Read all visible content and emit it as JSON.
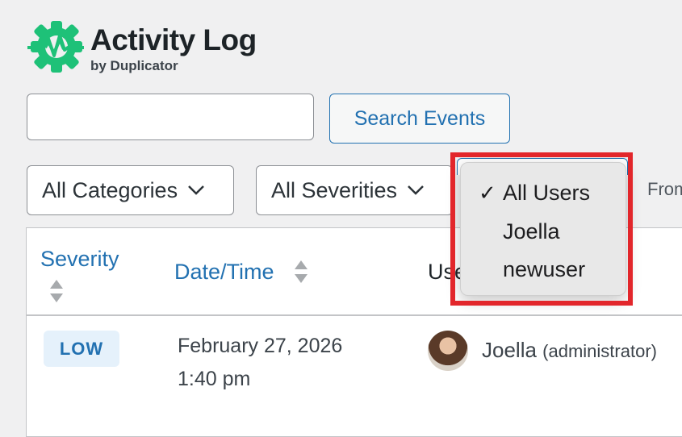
{
  "brand": {
    "title": "Activity Log",
    "subtitle": "by Duplicator",
    "color": "#1ec178"
  },
  "search": {
    "value": "",
    "placeholder": "",
    "button_label": "Search Events"
  },
  "filters": {
    "category": "All Categories",
    "severity": "All Severities",
    "from_label": "From"
  },
  "user_dropdown": {
    "options": [
      {
        "label": "All Users",
        "selected": true,
        "check": "✓"
      },
      {
        "label": "Joella",
        "selected": false,
        "check": ""
      },
      {
        "label": "newuser",
        "selected": false,
        "check": ""
      }
    ]
  },
  "table": {
    "columns": {
      "severity": "Severity",
      "datetime": "Date/Time",
      "user": "User"
    },
    "rows": [
      {
        "severity": "LOW",
        "date": "February 27, 2026",
        "time": "1:40 pm",
        "user_name": "Joella",
        "user_role": "(administrator)"
      }
    ]
  },
  "colors": {
    "accent": "#2271b1",
    "highlight": "#e2262b",
    "badge_bg": "#e5f1fb"
  }
}
